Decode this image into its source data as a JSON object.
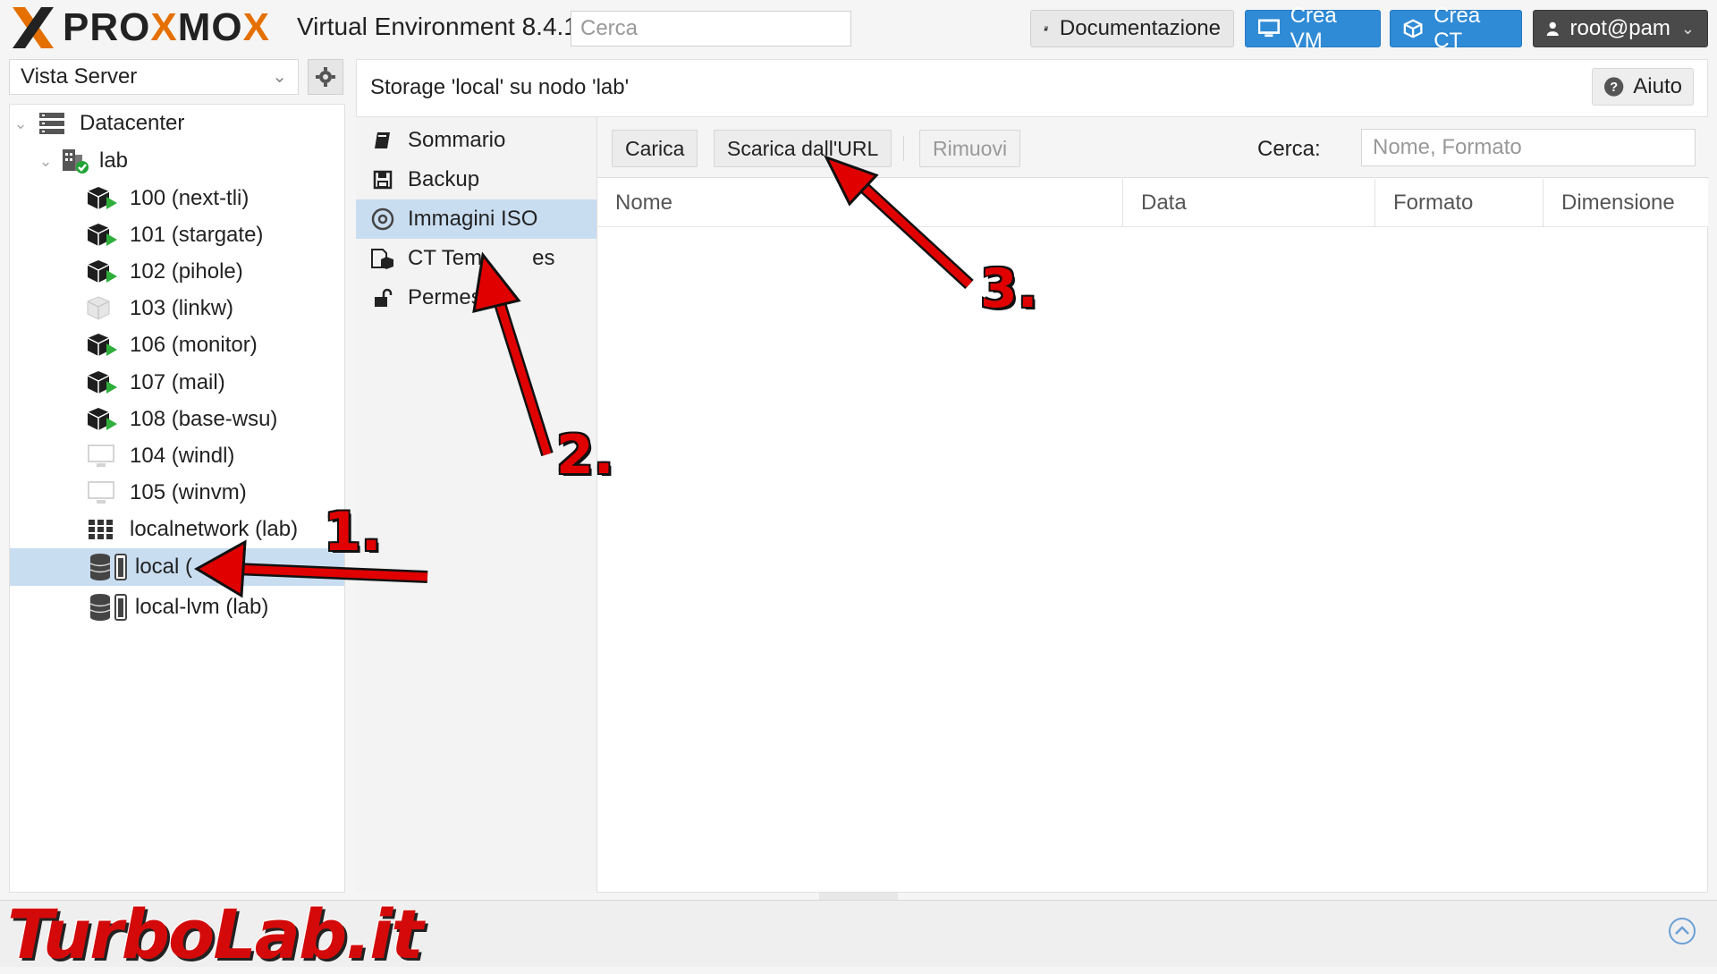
{
  "header": {
    "logo_text_1": "PRO",
    "logo_text_2": "X",
    "logo_text_3": "MO",
    "logo_text_4": "X",
    "title": "Virtual Environment 8.4.1",
    "search_placeholder": "Cerca",
    "docs_label": "Documentazione",
    "create_vm_label": "Crea VM",
    "create_ct_label": "Crea CT",
    "user_label": "root@pam"
  },
  "sidebar": {
    "view_label": "Vista Server",
    "tree": [
      {
        "label": "Datacenter",
        "icon": "datacenter-icon"
      },
      {
        "label": "lab",
        "icon": "node-icon"
      },
      {
        "label": "100 (next-tli)",
        "icon": "container-running-icon"
      },
      {
        "label": "101 (stargate)",
        "icon": "container-running-icon"
      },
      {
        "label": "102 (pihole)",
        "icon": "container-running-icon"
      },
      {
        "label": "103 (linkw)",
        "icon": "container-stopped-icon"
      },
      {
        "label": "106 (monitor)",
        "icon": "container-running-icon"
      },
      {
        "label": "107 (mail)",
        "icon": "container-running-icon"
      },
      {
        "label": "108 (base-wsu)",
        "icon": "container-running-icon"
      },
      {
        "label": "104 (windl)",
        "icon": "vm-stopped-icon"
      },
      {
        "label": "105 (winvm)",
        "icon": "vm-stopped-icon"
      },
      {
        "label": "localnetwork (lab)",
        "icon": "network-grid-icon"
      },
      {
        "label": "local (",
        "icon": "storage-icon"
      },
      {
        "label": "local-lvm (lab)",
        "icon": "storage-icon"
      }
    ]
  },
  "main": {
    "title": "Storage 'local' su nodo 'lab'",
    "help_label": "Aiuto",
    "menu": [
      {
        "label": "Sommario",
        "icon": "book-icon"
      },
      {
        "label": "Backup",
        "icon": "floppy-icon"
      },
      {
        "label": "Immagini ISO",
        "icon": "disc-icon"
      },
      {
        "label": "CT Tem",
        "label2": "es",
        "icon": "ct-template-icon"
      },
      {
        "label": "Permessi",
        "icon": "unlock-icon"
      }
    ],
    "toolbar": {
      "upload": "Carica",
      "download_url": "Scarica dall'URL",
      "remove": "Rimuovi",
      "search_label": "Cerca:",
      "search_placeholder": "Nome, Formato"
    },
    "columns": [
      "Nome",
      "Data",
      "Formato",
      "Dimensione"
    ]
  },
  "annotations": [
    "1.",
    "2.",
    "3."
  ],
  "watermark": "TurboLab.it",
  "colors": {
    "accent": "#2f8bd6",
    "selected": "#c9ddf1",
    "brand_orange": "#e57000",
    "arrow_red": "#e00000"
  }
}
